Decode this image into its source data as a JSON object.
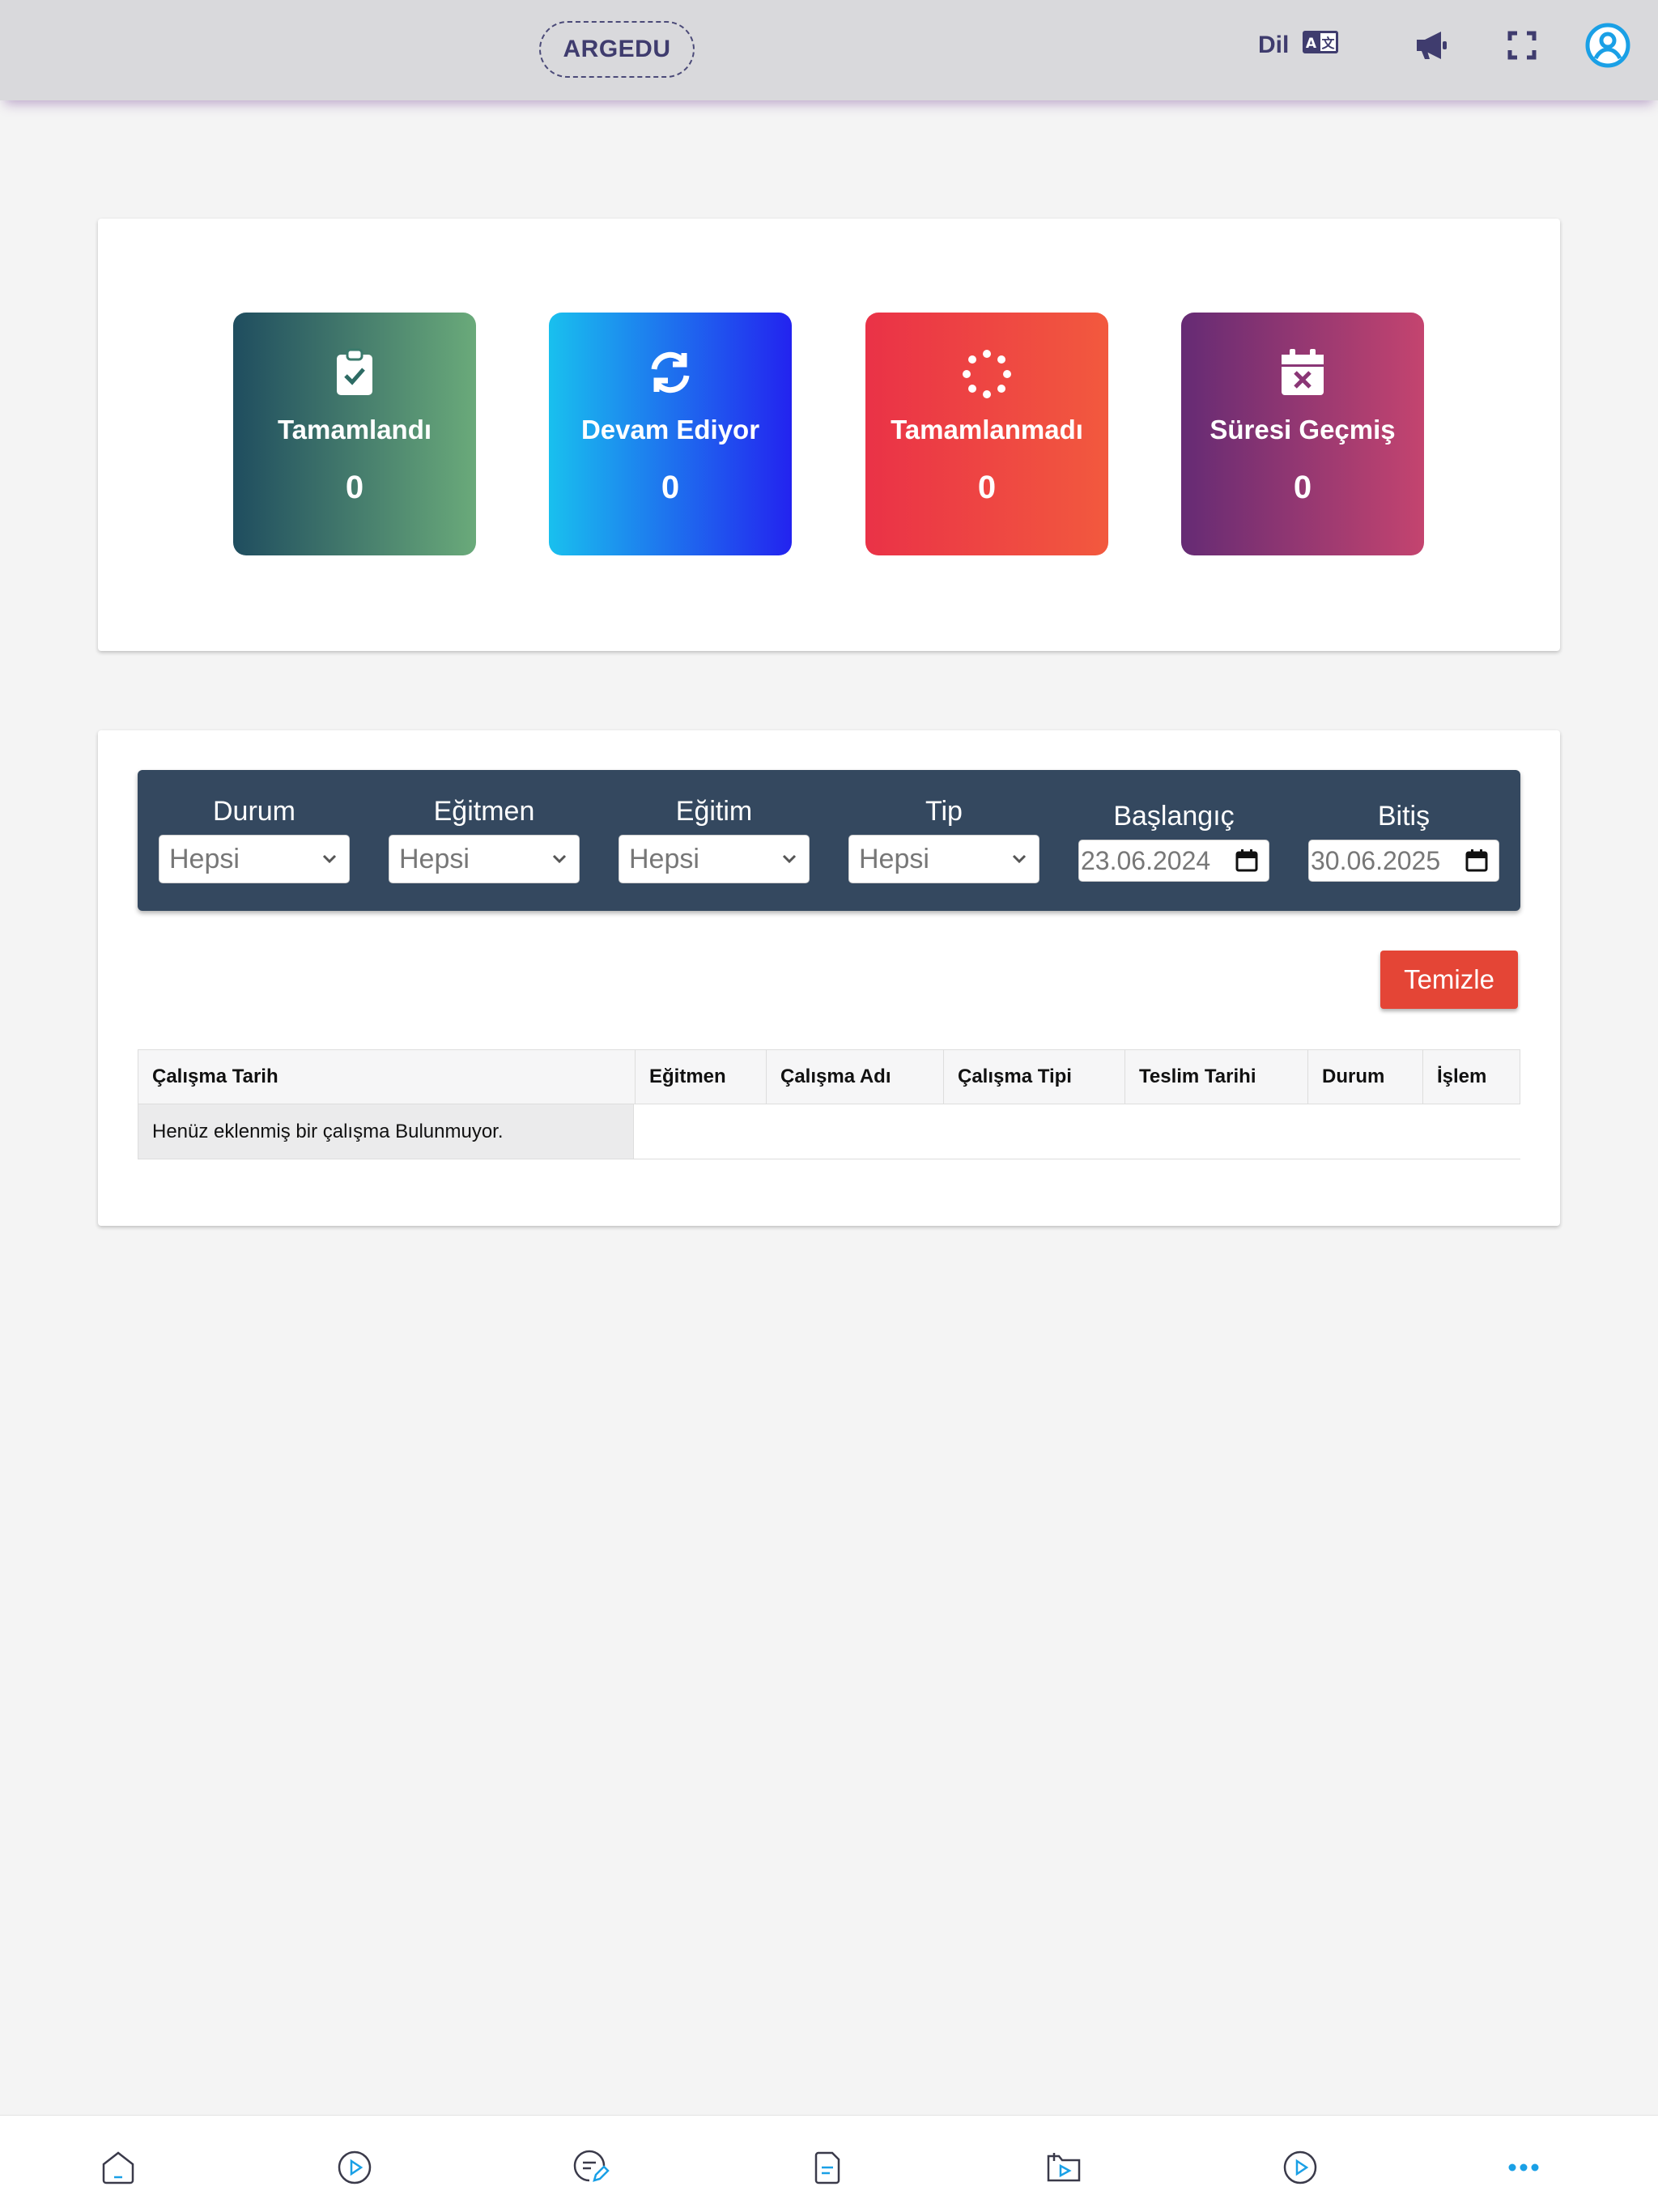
{
  "header": {
    "brand": "ARGEDU",
    "language_label": "Dil",
    "language_icon": "translate-icon",
    "announcement_icon": "megaphone-icon",
    "fullscreen_icon": "fullscreen-icon",
    "profile_icon": "user-circle-icon"
  },
  "stats": [
    {
      "label": "Tamamlandı",
      "value": "0",
      "icon": "clipboard-check-icon"
    },
    {
      "label": "Devam Ediyor",
      "value": "0",
      "icon": "sync-icon"
    },
    {
      "label": "Tamamlanmadı",
      "value": "0",
      "icon": "spinner-icon"
    },
    {
      "label": "Süresi Geçmiş",
      "value": "0",
      "icon": "calendar-x-icon"
    }
  ],
  "filters": {
    "durum": {
      "label": "Durum",
      "value": "Hepsi"
    },
    "egitmen": {
      "label": "Eğitmen",
      "value": "Hepsi"
    },
    "egitim": {
      "label": "Eğitim",
      "value": "Hepsi"
    },
    "tip": {
      "label": "Tip",
      "value": "Hepsi"
    },
    "baslangic": {
      "label": "Başlangıç",
      "value": "23.06.2024"
    },
    "bitis": {
      "label": "Bitiş",
      "value": "30.06.2025"
    }
  },
  "clear_button": "Temizle",
  "table": {
    "columns": [
      "Çalışma Tarih",
      "Eğitmen",
      "Çalışma Adı",
      "Çalışma Tipi",
      "Teslim Tarihi",
      "Durum",
      "İşlem"
    ],
    "empty_message": "Henüz eklenmiş bir çalışma Bulunmuyor."
  },
  "colors": {
    "header_bg": "#d9d9dc",
    "filter_bar_bg": "#34485f",
    "clear_button_bg": "#e44536",
    "brand_text": "#3f3c6e"
  },
  "bottom_nav": [
    {
      "icon": "home-icon"
    },
    {
      "icon": "play-circle-icon"
    },
    {
      "icon": "edit-note-icon"
    },
    {
      "icon": "document-icon"
    },
    {
      "icon": "video-folder-icon"
    },
    {
      "icon": "play-circle-icon"
    },
    {
      "icon": "more-icon"
    }
  ]
}
